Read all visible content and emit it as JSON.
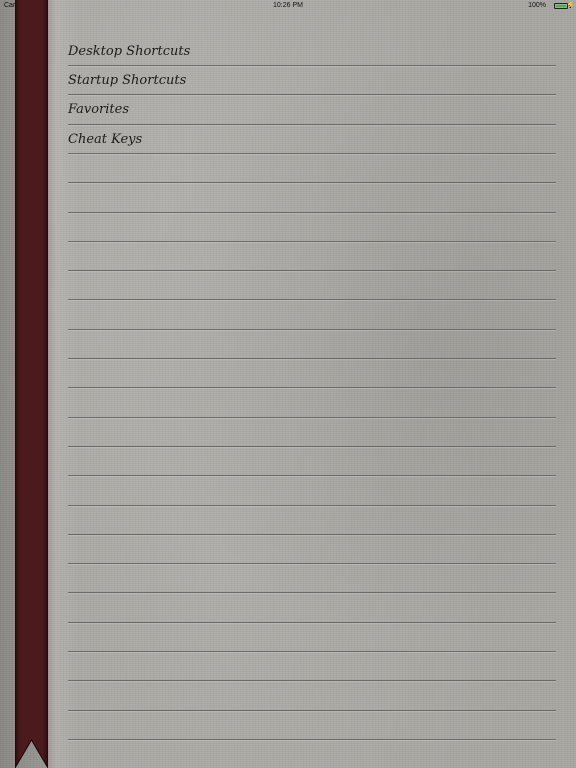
{
  "status_bar": {
    "carrier": "Carrier",
    "time": "10:26 PM",
    "battery_percent": "100%",
    "battery_level": 1.0,
    "battery_color": "#3dbb3d"
  },
  "ribbon": {
    "color": "#4a1a1c"
  },
  "menu": {
    "items": [
      {
        "label": "Desktop Shortcuts"
      },
      {
        "label": "Startup Shortcuts"
      },
      {
        "label": "Favorites"
      },
      {
        "label": "Cheat Keys"
      }
    ]
  }
}
